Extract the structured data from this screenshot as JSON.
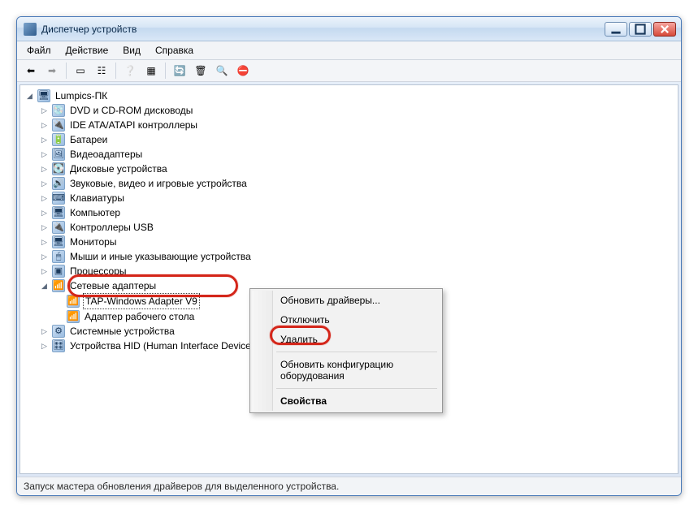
{
  "window": {
    "title": "Диспетчер устройств"
  },
  "menu": {
    "file": "Файл",
    "action": "Действие",
    "view": "Вид",
    "help": "Справка"
  },
  "toolbar": {
    "back": "←",
    "forward": "→",
    "show_hidden": "▭",
    "props": "☰",
    "help": "?",
    "refresh": "▦",
    "update": "⟳",
    "uninstall": "✖",
    "scan": "⚙",
    "enable": "◆"
  },
  "tree": {
    "root": "Lumpics-ПК",
    "nodes": [
      "DVD и CD-ROM дисководы",
      "IDE ATA/ATAPI контроллеры",
      "Батареи",
      "Видеоадаптеры",
      "Дисковые устройства",
      "Звуковые, видео и игровые устройства",
      "Клавиатуры",
      "Компьютер",
      "Контроллеры USB",
      "Мониторы",
      "Мыши и иные указывающие устройства",
      "Процессоры"
    ],
    "net_category": "Сетевые адаптеры",
    "net_items": [
      "TAP-Windows Adapter V9",
      "Адаптер рабочего стола"
    ],
    "after": [
      "Системные устройства",
      "Устройства HID (Human Interface Devices)"
    ]
  },
  "context": {
    "update": "Обновить драйверы...",
    "disable": "Отключить",
    "delete": "Удалить",
    "rescan": "Обновить конфигурацию оборудования",
    "properties": "Свойства"
  },
  "status": "Запуск мастера обновления драйверов для выделенного устройства."
}
